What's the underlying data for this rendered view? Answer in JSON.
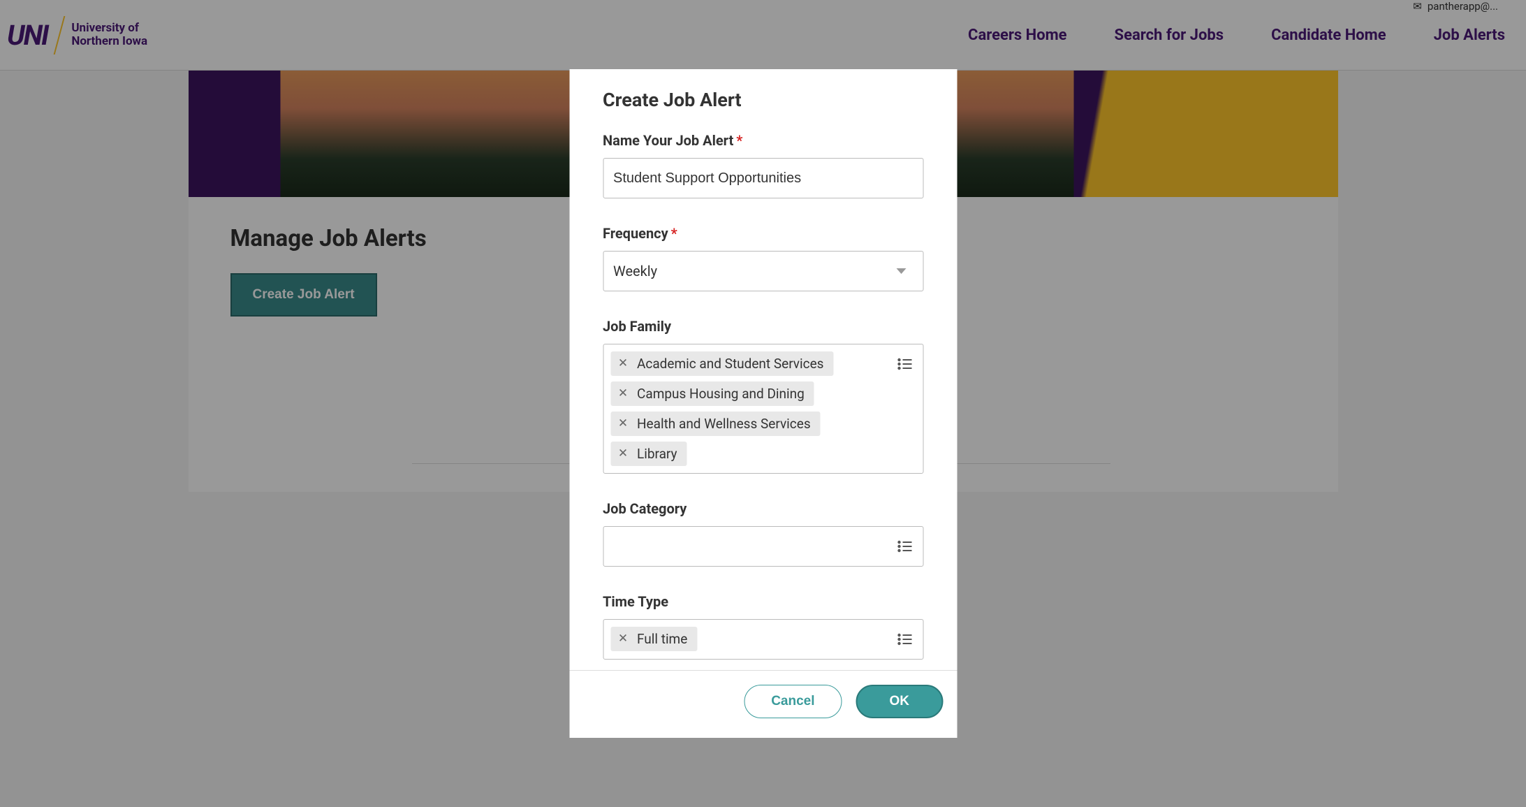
{
  "header": {
    "logo_main": "UNI",
    "logo_sub": "University of\nNorthern Iowa",
    "email": "pantherapp@..."
  },
  "nav": {
    "items": [
      "Careers Home",
      "Search for Jobs",
      "Candidate Home",
      "Job Alerts"
    ]
  },
  "page": {
    "title": "Manage Job Alerts",
    "create_button": "Create Job Alert"
  },
  "modal": {
    "title": "Create Job Alert",
    "name_label": "Name Your Job Alert",
    "name_value": "Student Support Opportunities",
    "frequency_label": "Frequency",
    "frequency_value": "Weekly",
    "job_family_label": "Job Family",
    "job_family_chips": [
      "Academic and Student Services",
      "Campus Housing and Dining",
      "Health and Wellness Services",
      "Library"
    ],
    "job_category_label": "Job Category",
    "time_type_label": "Time Type",
    "time_type_chips": [
      "Full time"
    ],
    "cancel": "Cancel",
    "ok": "OK"
  }
}
